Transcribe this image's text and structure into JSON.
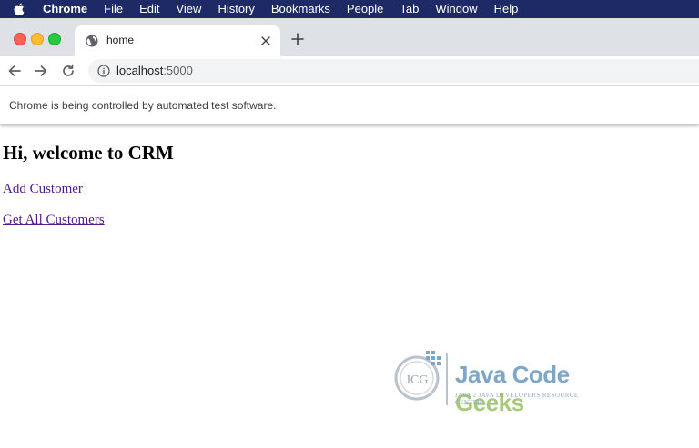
{
  "menubar": {
    "app_name": "Chrome",
    "items": [
      "File",
      "Edit",
      "View",
      "History",
      "Bookmarks",
      "People",
      "Tab",
      "Window",
      "Help"
    ]
  },
  "tab": {
    "title": "home",
    "favicon": "globe-icon"
  },
  "toolbar": {
    "url_host": "localhost",
    "url_port": ":5000"
  },
  "infobar": {
    "text": "Chrome is being controlled by automated test software."
  },
  "page": {
    "heading": "Hi, welcome to CRM",
    "links": [
      "Add Customer",
      "Get All Customers"
    ]
  },
  "watermark": {
    "logo_initials": "JCG",
    "title_part1": "Java Code ",
    "title_part2": "Geeks",
    "subtitle": "Java 2 Java Developers Resource Center"
  },
  "colors": {
    "menubar": "#1e2a66",
    "tabstrip": "#dee1e6",
    "link_visited": "#551a8b"
  }
}
